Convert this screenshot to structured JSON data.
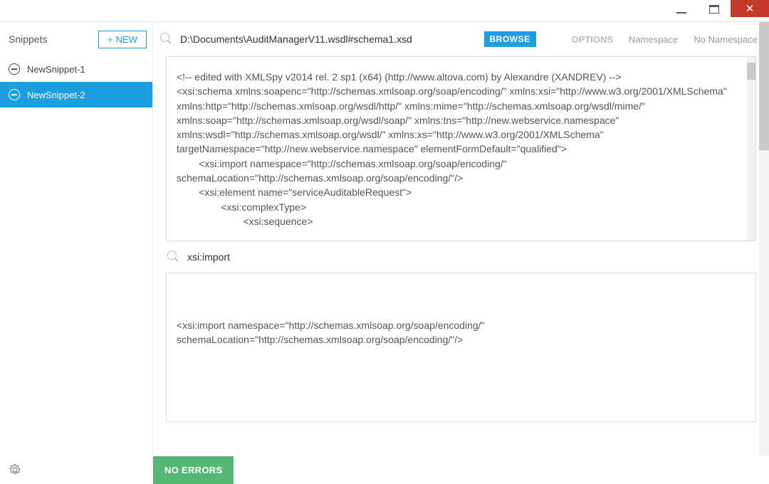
{
  "window": {
    "close_glyph": "✕"
  },
  "sidebar": {
    "title": "Snippets",
    "new_label": "NEW",
    "items": [
      {
        "label": "NewSnippet-1"
      },
      {
        "label": "NewSnippet-2"
      }
    ]
  },
  "topbar": {
    "path": "D:\\Documents\\AuditManagerV11.wsdl#schema1.xsd",
    "browse_label": "BROWSE",
    "options_label": "OPTIONS",
    "namespace_label": "Namespace",
    "no_namespace_label": "No Namespace"
  },
  "source": {
    "text": "<!-- edited with XMLSpy v2014 rel. 2 sp1 (x64) (http://www.altova.com) by Alexandre (XANDREV) -->\n<xsi:schema xmlns:soapenc=\"http://schemas.xmlsoap.org/soap/encoding/\" xmlns:xsi=\"http://www.w3.org/2001/XMLSchema\" xmlns:http=\"http://schemas.xmlsoap.org/wsdl/http/\" xmlns:mime=\"http://schemas.xmlsoap.org/wsdl/mime/\" xmlns:soap=\"http://schemas.xmlsoap.org/wsdl/soap/\" xmlns:tns=\"http://new.webservice.namespace\" xmlns:wsdl=\"http://schemas.xmlsoap.org/wsdl/\" xmlns:xs=\"http://www.w3.org/2001/XMLSchema\" targetNamespace=\"http://new.webservice.namespace\" elementFormDefault=\"qualified\">\n        <xsi:import namespace=\"http://schemas.xmlsoap.org/soap/encoding/\" schemaLocation=\"http://schemas.xmlsoap.org/soap/encoding/\"/>\n        <xsi:element name=\"serviceAuditableRequest\">\n                <xsi:complexType>\n                        <xsi:sequence>"
  },
  "search": {
    "term": "xsi:import"
  },
  "result": {
    "text": "<xsi:import namespace=\"http://schemas.xmlsoap.org/soap/encoding/\" schemaLocation=\"http://schemas.xmlsoap.org/soap/encoding/\"/>"
  },
  "status": {
    "label": "NO ERRORS"
  }
}
